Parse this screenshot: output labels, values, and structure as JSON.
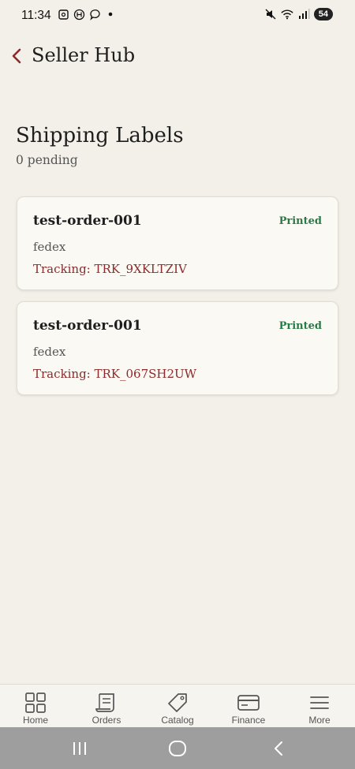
{
  "status_bar": {
    "time": "11:34",
    "battery": "54"
  },
  "header": {
    "title": "Seller Hub"
  },
  "section": {
    "title": "Shipping Labels",
    "subtitle": "0 pending"
  },
  "labels": [
    {
      "order": "test-order-001",
      "status": "Printed",
      "carrier": "fedex",
      "tracking": "Tracking: TRK_9XKLTZIV"
    },
    {
      "order": "test-order-001",
      "status": "Printed",
      "carrier": "fedex",
      "tracking": "Tracking: TRK_067SH2UW"
    }
  ],
  "bottom_nav": [
    {
      "label": "Home",
      "icon": "grid-icon"
    },
    {
      "label": "Orders",
      "icon": "receipt-icon"
    },
    {
      "label": "Catalog",
      "icon": "tag-icon"
    },
    {
      "label": "Finance",
      "icon": "card-icon"
    },
    {
      "label": "More",
      "icon": "menu-icon"
    }
  ],
  "colors": {
    "accent": "#8b2a2a",
    "status_printed": "#2a7a47",
    "background": "#f3f0e9"
  }
}
